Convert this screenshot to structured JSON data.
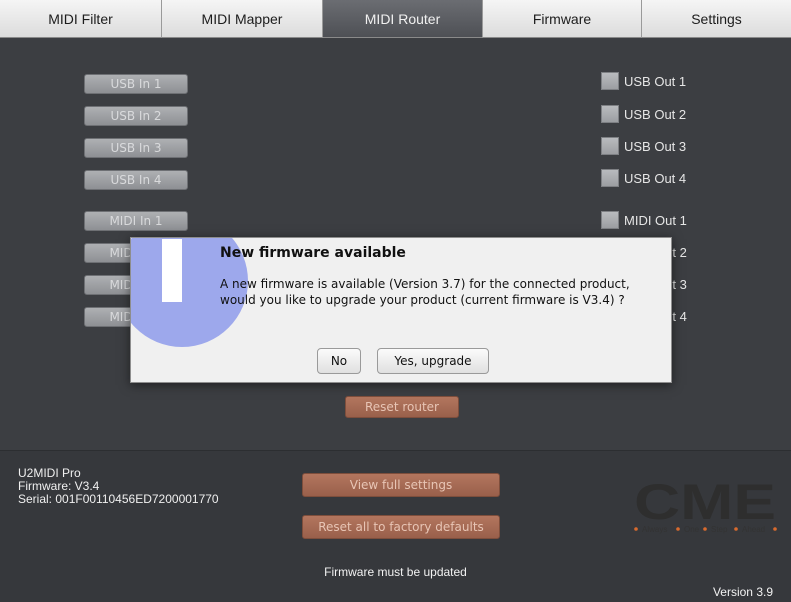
{
  "tabs": [
    "MIDI Filter",
    "MIDI Mapper",
    "MIDI Router",
    "Firmware",
    "Settings"
  ],
  "active_tab": "MIDI Router",
  "inputs": [
    "USB In 1",
    "USB In 2",
    "USB In 3",
    "USB In 4",
    "MIDI In 1",
    "MIDI In 2",
    "MIDI In 3",
    "MIDI In 4"
  ],
  "outputs": [
    "USB Out 1",
    "USB Out 2",
    "USB Out 3",
    "USB Out 4",
    "MIDI Out 1",
    "MIDI Out 2",
    "MIDI Out 3",
    "MIDI Out 4"
  ],
  "router": {
    "reset_label": "Reset router"
  },
  "device": {
    "name": "U2MIDI Pro",
    "firmware": "Firmware: V3.4",
    "serial": "Serial: 001F00110456ED7200001770"
  },
  "footer": {
    "view_settings_label": "View full settings",
    "factory_reset_label": "Reset all to factory defaults",
    "status": "Firmware must be updated",
    "version": "Version 3.9"
  },
  "logo": {
    "brand": "CME",
    "tagline": [
      "Always",
      "One",
      "Step",
      "Ahead"
    ]
  },
  "dialog": {
    "title": "New firmware available",
    "line1": "A new firmware is available (Version 3.7) for the connected product,",
    "line2": "would you like to upgrade your product (current firmware is V3.4) ?",
    "no_label": "No",
    "yes_label": "Yes, upgrade"
  },
  "colors": {
    "background": "#3c3e42",
    "accent_button": "#a86b55",
    "info_icon": "#9da8ec",
    "logo": "#2e2e2e"
  }
}
